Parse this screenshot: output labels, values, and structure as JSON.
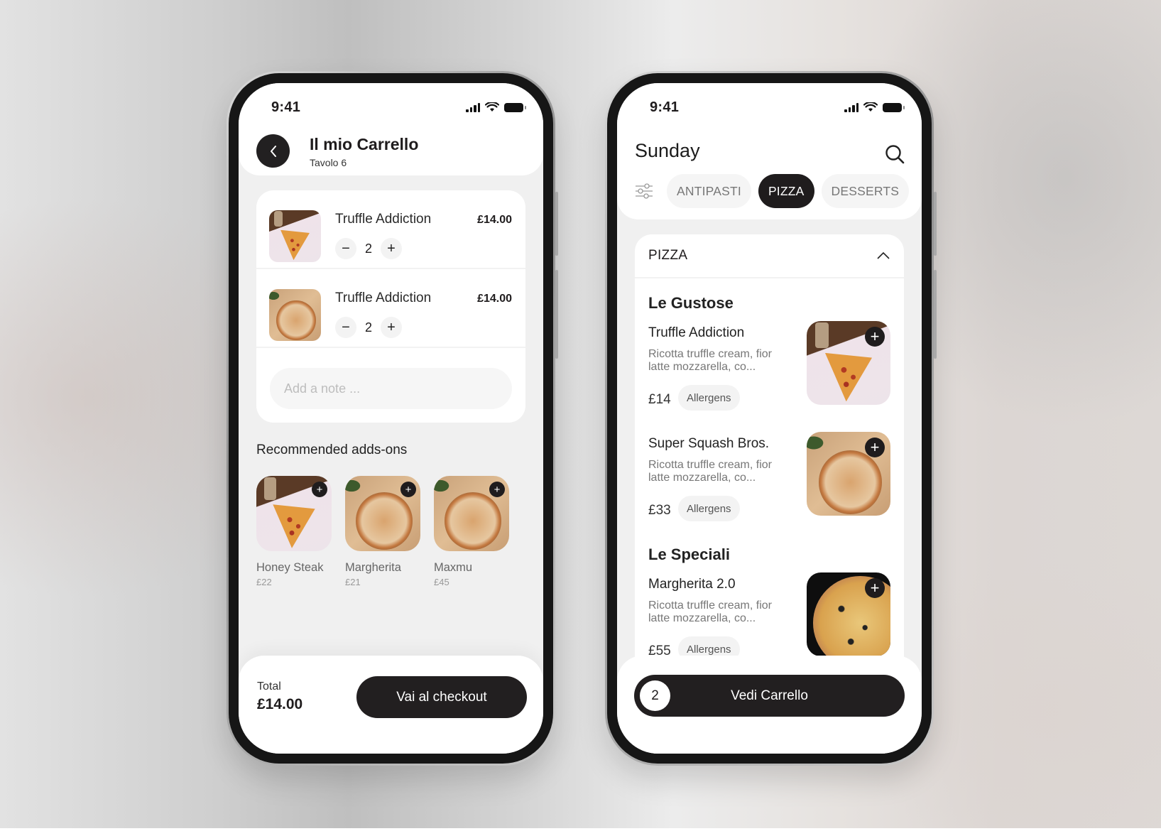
{
  "status_bar": {
    "time": "9:41"
  },
  "cart_screen": {
    "title": "Il mio Carrello",
    "subtitle": "Tavolo 6",
    "items": [
      {
        "name": "Truffle Addiction",
        "price": "£14.00",
        "quantity": "2",
        "image": "pizza-slice"
      },
      {
        "name": "Truffle Addiction",
        "price": "£14.00",
        "quantity": "2",
        "image": "pizza-board"
      }
    ],
    "note_placeholder": "Add a note ...",
    "recommended_title": "Recommended adds-ons",
    "recommended": [
      {
        "name": "Honey Steak",
        "price": "£22",
        "image": "pizza-slice"
      },
      {
        "name": "Margherita",
        "price": "£21",
        "image": "pizza-board"
      },
      {
        "name": "Maxmu",
        "price": "£45",
        "image": "pizza-board"
      }
    ],
    "total_label": "Total",
    "total_value": "£14.00",
    "checkout_label": "Vai al checkout"
  },
  "menu_screen": {
    "title": "Sunday",
    "tabs": [
      {
        "label": "ANTIPASTI",
        "active": false
      },
      {
        "label": "PIZZA",
        "active": true
      },
      {
        "label": "DESSERTS",
        "active": false
      }
    ],
    "section_label": "PIZZA",
    "groups": [
      {
        "title": "Le Gustose",
        "dishes": [
          {
            "name": "Truffle Addiction",
            "description": "Ricotta truffle cream, fior latte mozzarella, co...",
            "price": "£14",
            "allergens_label": "Allergens",
            "image": "pizza-slice"
          },
          {
            "name": "Super Squash Bros.",
            "description": "Ricotta truffle cream, fior latte mozzarella, co...",
            "price": "£33",
            "allergens_label": "Allergens",
            "image": "pizza-board"
          }
        ]
      },
      {
        "title": "Le Speciali",
        "dishes": [
          {
            "name": "Margherita 2.0",
            "description": "Ricotta truffle cream, fior latte mozzarella, co...",
            "price": "£55",
            "allergens_label": "Allergens",
            "image": "pizza-margherita"
          }
        ]
      }
    ],
    "cart_count": "2",
    "cart_button_label": "Vedi Carrello"
  },
  "colors": {
    "primary_dark": "#1f1c1d",
    "screen_bg": "#f0f0f0",
    "chip_bg": "#f5f5f5"
  }
}
